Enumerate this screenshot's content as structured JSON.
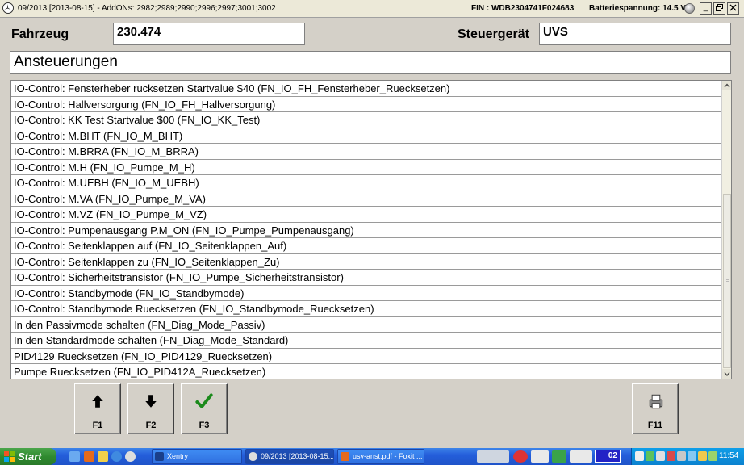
{
  "titlebar": {
    "title": "09/2013 [2013-08-15] - AddONs: 2982;2989;2990;2996;2997;3001;3002",
    "fin": "FIN : WDB2304741F024683",
    "battery": "Batteriespannung: 14.5 V",
    "buttons": {
      "minimize": "_",
      "restore": "🗗",
      "close": "✕"
    }
  },
  "header": {
    "vehicle_label": "Fahrzeug",
    "vehicle_value": "230.474",
    "ecu_label": "Steuergerät",
    "ecu_value": "UVS"
  },
  "section_title": "Ansteuerungen",
  "list": {
    "items": [
      "IO-Control: Fensterheber rucksetzen Startvalue $40 (FN_IO_FH_Fensterheber_Ruecksetzen)",
      "IO-Control: Hallversorgung (FN_IO_FH_Hallversorgung)",
      "IO-Control: KK Test Startvalue $00 (FN_IO_KK_Test)",
      "IO-Control: M.BHT (FN_IO_M_BHT)",
      "IO-Control: M.BRRA (FN_IO_M_BRRA)",
      "IO-Control: M.H (FN_IO_Pumpe_M_H)",
      "IO-Control: M.UEBH (FN_IO_M_UEBH)",
      "IO-Control: M.VA (FN_IO_Pumpe_M_VA)",
      "IO-Control: M.VZ (FN_IO_Pumpe_M_VZ)",
      "IO-Control: Pumpenausgang P.M_ON (FN_IO_Pumpe_Pumpenausgang)",
      "IO-Control: Seitenklappen auf (FN_IO_Seitenklappen_Auf)",
      "IO-Control: Seitenklappen zu (FN_IO_Seitenklappen_Zu)",
      "IO-Control: Sicherheitstransistor (FN_IO_Pumpe_Sicherheitstransistor)",
      "IO-Control: Standbymode (FN_IO_Standbymode)",
      "IO-Control: Standbymode Ruecksetzen (FN_IO_Standbymode_Ruecksetzen)",
      "In den Passivmode schalten (FN_Diag_Mode_Passiv)",
      "In den Standardmode schalten (FN_Diag_Mode_Standard)",
      "PID4129 Ruecksetzen (FN_IO_PID4129_Ruecksetzen)",
      "Pumpe Ruecksetzen (FN_IO_PID412A_Ruecksetzen)"
    ]
  },
  "function_keys": {
    "f1": {
      "label": "F1",
      "icon": "arrow-up-icon"
    },
    "f2": {
      "label": "F2",
      "icon": "arrow-down-icon"
    },
    "f3": {
      "label": "F3",
      "icon": "checkmark-icon"
    },
    "f11": {
      "label": "F11",
      "icon": "printer-icon"
    }
  },
  "taskbar": {
    "start_label": "Start",
    "tasks": [
      {
        "label": "Xentry",
        "icon": "xentry-icon"
      },
      {
        "label": "09/2013 [2013-08-15...",
        "icon": "star-icon"
      },
      {
        "label": "usv-anst.pdf - Foxit ...",
        "icon": "pdf-icon"
      }
    ],
    "badge": "02",
    "clock": "11:54"
  },
  "colors": {
    "window_bg": "#d4d0c8",
    "taskbar": "#245edb",
    "start": "#2f8a2f",
    "tray": "#0b82cf"
  }
}
